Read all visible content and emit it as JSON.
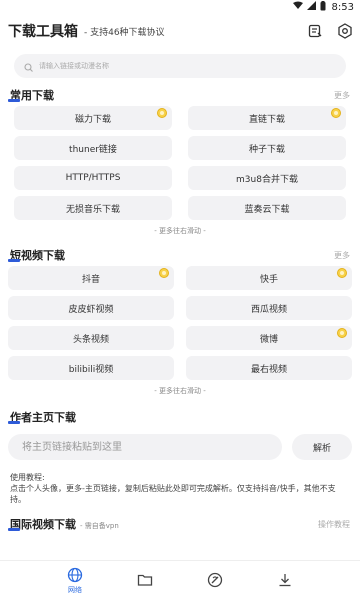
{
  "status": {
    "time": "8:53"
  },
  "header": {
    "title": "下载工具箱",
    "subtitle": "- 支持46种下载协议",
    "icons": [
      "notes-icon",
      "settings-icon"
    ]
  },
  "search": {
    "placeholder": "请输入链接或动漫名称"
  },
  "common": {
    "title": "常用下载",
    "more": "更多",
    "items": [
      "磁力下载",
      "直链下载",
      "thuner链接",
      "种子下载",
      "HTTP/HTTPS",
      "m3u8合并下载",
      "无损音乐下载",
      "蓝奏云下载"
    ],
    "hint": "- 更多往右滑动 -"
  },
  "short_video": {
    "title": "短视频下载",
    "more": "更多",
    "items": [
      "抖音",
      "快手",
      "皮皮虾视频",
      "西瓜视频",
      "头条视频",
      "微博",
      "bilibili视频",
      "最右视频"
    ],
    "hint": "- 更多往右滑动 -"
  },
  "author": {
    "title": "作者主页下载",
    "input_placeholder": "将主页链接粘贴到这里",
    "parse": "解析",
    "tutorial_line1": "使用教程:",
    "tutorial_line2": "点击个人头像，更多-主页链接，复制后粘贴此处即可完成解析。仅支持抖音/快手，其他不支持。"
  },
  "international": {
    "title": "国际视频下载",
    "note": "- 需自备vpn",
    "more": "操作教程"
  },
  "bottom_nav": {
    "active_label": "网络"
  },
  "colors": {
    "accent": "#2a6ae0",
    "tile_bg": "#f2f2f4",
    "badge": "#f7d24a"
  }
}
